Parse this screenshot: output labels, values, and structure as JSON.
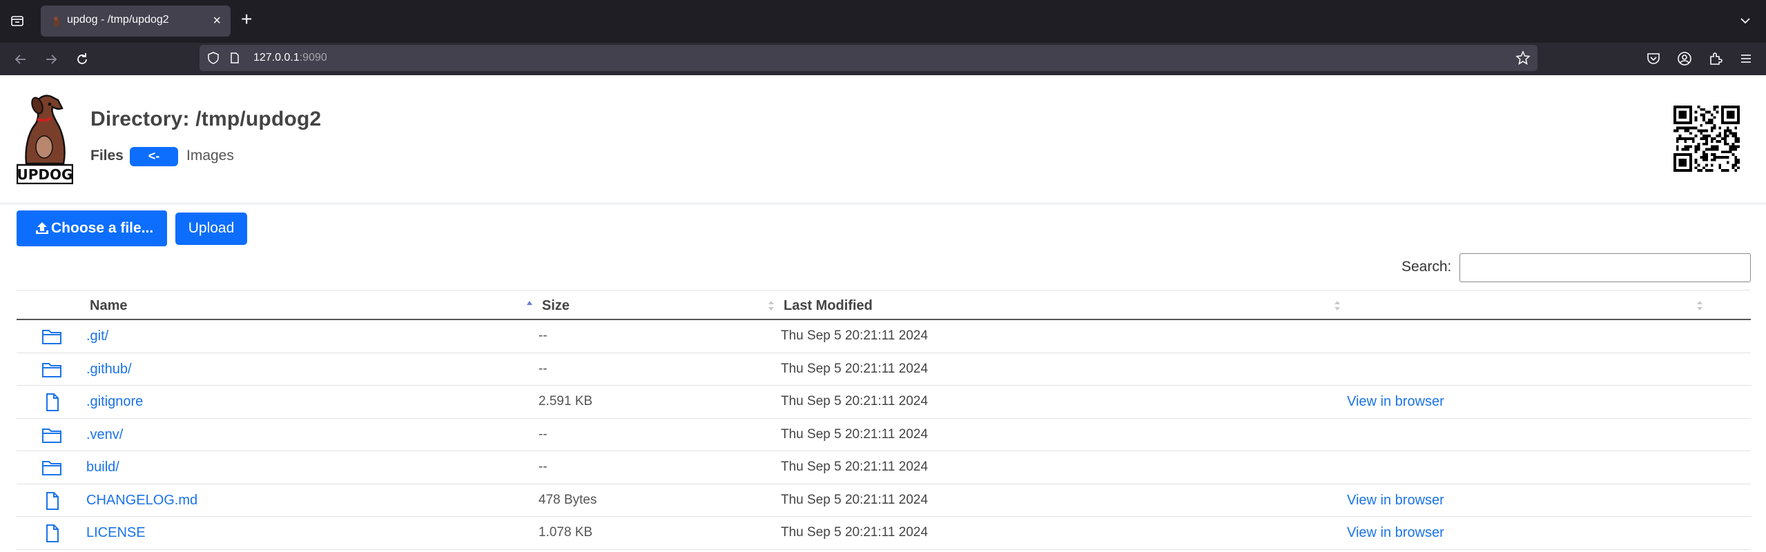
{
  "browser": {
    "tab_title": "updog - /tmp/updog2",
    "url_host": "127.0.0.1",
    "url_port": ":9090"
  },
  "header": {
    "directory_title": "Directory: /tmp/updog2",
    "files_label": "Files",
    "toggle_label": "<-",
    "images_label": "Images",
    "logo_text": "UPDOG"
  },
  "upload": {
    "choose_label": "Choose a file...",
    "upload_label": "Upload"
  },
  "search": {
    "label": "Search:",
    "value": ""
  },
  "table": {
    "columns": [
      "Name",
      "Size",
      "Last Modified",
      ""
    ],
    "sorted_column": "Name",
    "rows": [
      {
        "type": "folder",
        "name": ".git/",
        "size": "--",
        "modified": "Thu Sep 5 20:21:11 2024",
        "action": ""
      },
      {
        "type": "folder",
        "name": ".github/",
        "size": "--",
        "modified": "Thu Sep 5 20:21:11 2024",
        "action": ""
      },
      {
        "type": "file",
        "name": ".gitignore",
        "size": "2.591 KB",
        "modified": "Thu Sep 5 20:21:11 2024",
        "action": "View in browser"
      },
      {
        "type": "folder",
        "name": ".venv/",
        "size": "--",
        "modified": "Thu Sep 5 20:21:11 2024",
        "action": ""
      },
      {
        "type": "folder",
        "name": "build/",
        "size": "--",
        "modified": "Thu Sep 5 20:21:11 2024",
        "action": ""
      },
      {
        "type": "file",
        "name": "CHANGELOG.md",
        "size": "478 Bytes",
        "modified": "Thu Sep 5 20:21:11 2024",
        "action": "View in browser"
      },
      {
        "type": "file",
        "name": "LICENSE",
        "size": "1.078 KB",
        "modified": "Thu Sep 5 20:21:11 2024",
        "action": "View in browser"
      }
    ]
  },
  "colors": {
    "accent": "#0d6efd",
    "link": "#1a73e8",
    "chrome_dark": "#1f1e25",
    "chrome_toolbar": "#2b2a33"
  },
  "icons": {
    "folder": "folder-icon",
    "file": "file-icon",
    "upload": "upload-icon",
    "qr": "qr-code-icon"
  }
}
